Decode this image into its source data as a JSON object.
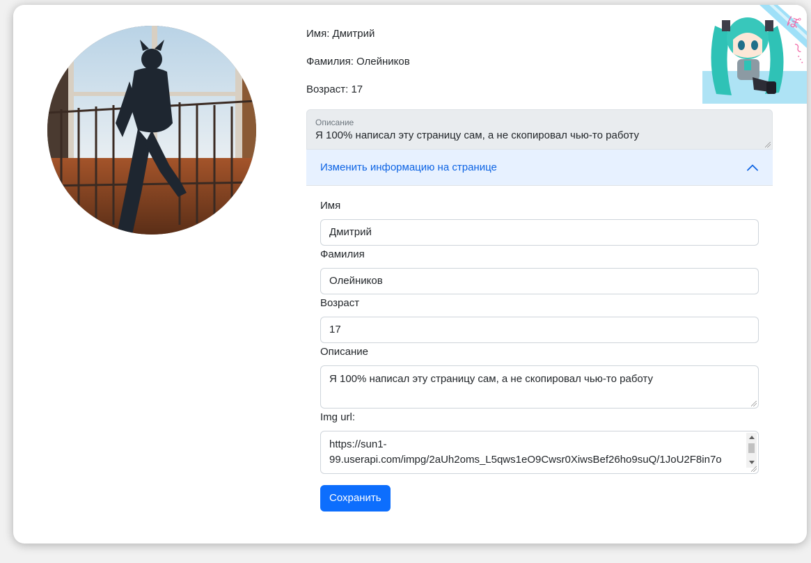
{
  "profile": {
    "avatar_alt": "profile photo",
    "first_name_line": "Имя: Дмитрий",
    "last_name_line": "Фамилия: Олейников",
    "age_line": "Возраст: 17",
    "description_label": "Описание",
    "description_text": "Я 100% написал эту страницу сам, а не скопировал чью-то работу"
  },
  "decoration": {
    "sticker_icon": "anime-character-sticker"
  },
  "accordion": {
    "title": "Изменить информацию на странице",
    "expanded": true,
    "icon": "chevron-up-icon"
  },
  "form": {
    "first_name": {
      "label": "Имя",
      "value": "Дмитрий"
    },
    "last_name": {
      "label": "Фамилия",
      "value": "Олейников"
    },
    "age": {
      "label": "Возраст",
      "value": "17"
    },
    "description": {
      "label": "Описание",
      "value": "Я 100% написал эту страницу сам, а не скопировал чью-то работу"
    },
    "img_url": {
      "label": "Img url:",
      "value_line1": "https://sun1-",
      "value_line2": "99.userapi.com/impg/2aUh2oms_L5qws1eO9Cwsr0XiwsBef26ho9suQ/1JoU2F8in7o"
    },
    "save_label": "Сохранить"
  },
  "colors": {
    "primary": "#0d6efd",
    "accordion_bg": "#e7f1ff",
    "accordion_text": "#0c63e4",
    "readonly_bg": "#e9ecef"
  }
}
